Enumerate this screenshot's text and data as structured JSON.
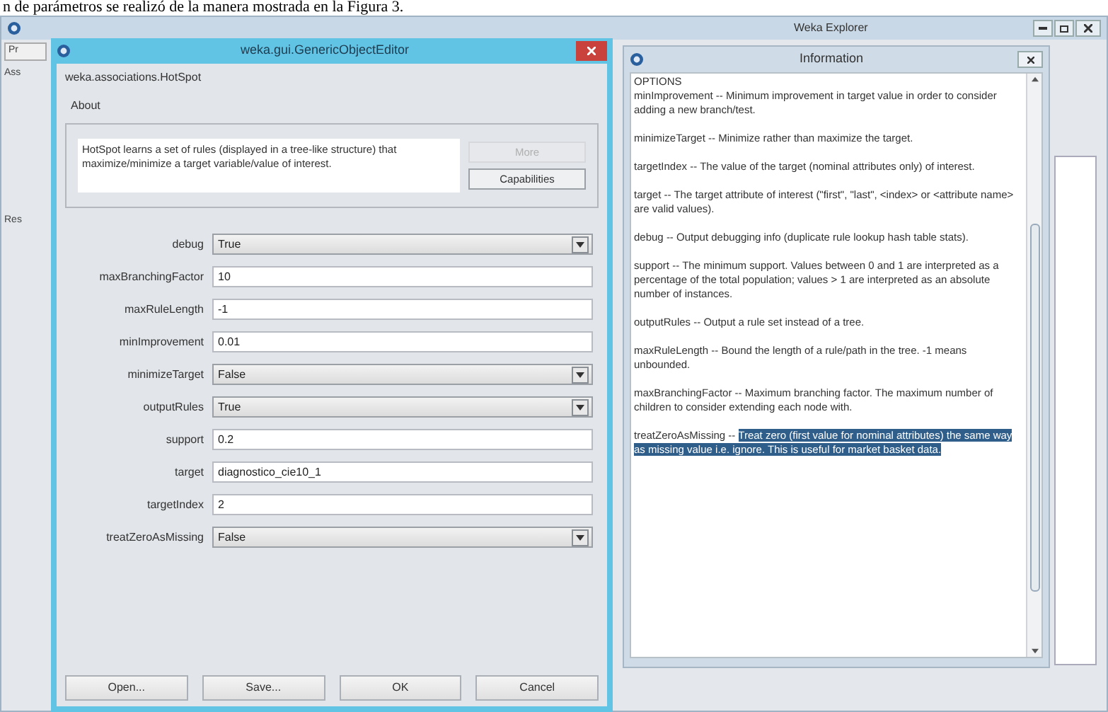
{
  "caption": "n de parámetros se realizó de la manera mostrada en la Figura 3.",
  "explorer": {
    "title": "Weka Explorer",
    "fragments": [
      "Pr",
      "Ass",
      "Res"
    ]
  },
  "editor": {
    "title": "weka.gui.GenericObjectEditor",
    "class_name": "weka.associations.HotSpot",
    "about": {
      "heading": "About",
      "text": "HotSpot learns a set of rules (displayed in a tree-like structure) that maximize/minimize a target variable/value of interest.",
      "more": {
        "label": "More",
        "disabled": true
      },
      "capabilities": {
        "label": "Capabilities",
        "disabled": false
      }
    },
    "properties": [
      {
        "label": "debug",
        "kind": "dropdown",
        "value": "True"
      },
      {
        "label": "maxBranchingFactor",
        "kind": "text",
        "value": "10"
      },
      {
        "label": "maxRuleLength",
        "kind": "text",
        "value": "-1"
      },
      {
        "label": "minImprovement",
        "kind": "text",
        "value": "0.01"
      },
      {
        "label": "minimizeTarget",
        "kind": "dropdown",
        "value": "False"
      },
      {
        "label": "outputRules",
        "kind": "dropdown",
        "value": "True"
      },
      {
        "label": "support",
        "kind": "text",
        "value": "0.2"
      },
      {
        "label": "target",
        "kind": "text",
        "value": "diagnostico_cie10_1"
      },
      {
        "label": "targetIndex",
        "kind": "text",
        "value": "2"
      },
      {
        "label": "treatZeroAsMissing",
        "kind": "dropdown",
        "value": "False"
      }
    ],
    "buttons": [
      "Open...",
      "Save...",
      "OK",
      "Cancel"
    ]
  },
  "information": {
    "title": "Information",
    "heading": "OPTIONS",
    "options": [
      {
        "name": "minImprovement --",
        "description": "Minimum improvement in target value in order to consider adding a new branch/test.",
        "selected": false
      },
      {
        "name": "minimizeTarget --",
        "description": "Minimize rather than maximize the target.",
        "selected": false
      },
      {
        "name": "targetIndex --",
        "description": "The value of the target (nominal attributes only) of interest.",
        "selected": false
      },
      {
        "name": "target --",
        "description": "The target attribute of interest (\"first\", \"last\", <index> or <attribute name> are valid values).",
        "selected": false
      },
      {
        "name": "debug --",
        "description": "Output debugging info (duplicate rule lookup hash table stats).",
        "selected": false
      },
      {
        "name": "support --",
        "description": "The minimum support. Values between 0 and 1 are interpreted as a percentage of the total population; values > 1 are interpreted as an absolute number of instances.",
        "selected": false
      },
      {
        "name": "outputRules --",
        "description": "Output a rule set instead of a tree.",
        "selected": false
      },
      {
        "name": "maxRuleLength --",
        "description": "Bound the length of a rule/path in the tree. -1 means unbounded.",
        "selected": false
      },
      {
        "name": "maxBranchingFactor --",
        "description": "Maximum branching factor. The maximum number of children to consider extending each node with.",
        "selected": false
      },
      {
        "name": "treatZeroAsMissing --",
        "description": "Treat zero (first value for nominal attributes) the same way as missing value i.e. ignore. This is useful for market basket data.",
        "selected": true
      }
    ]
  }
}
